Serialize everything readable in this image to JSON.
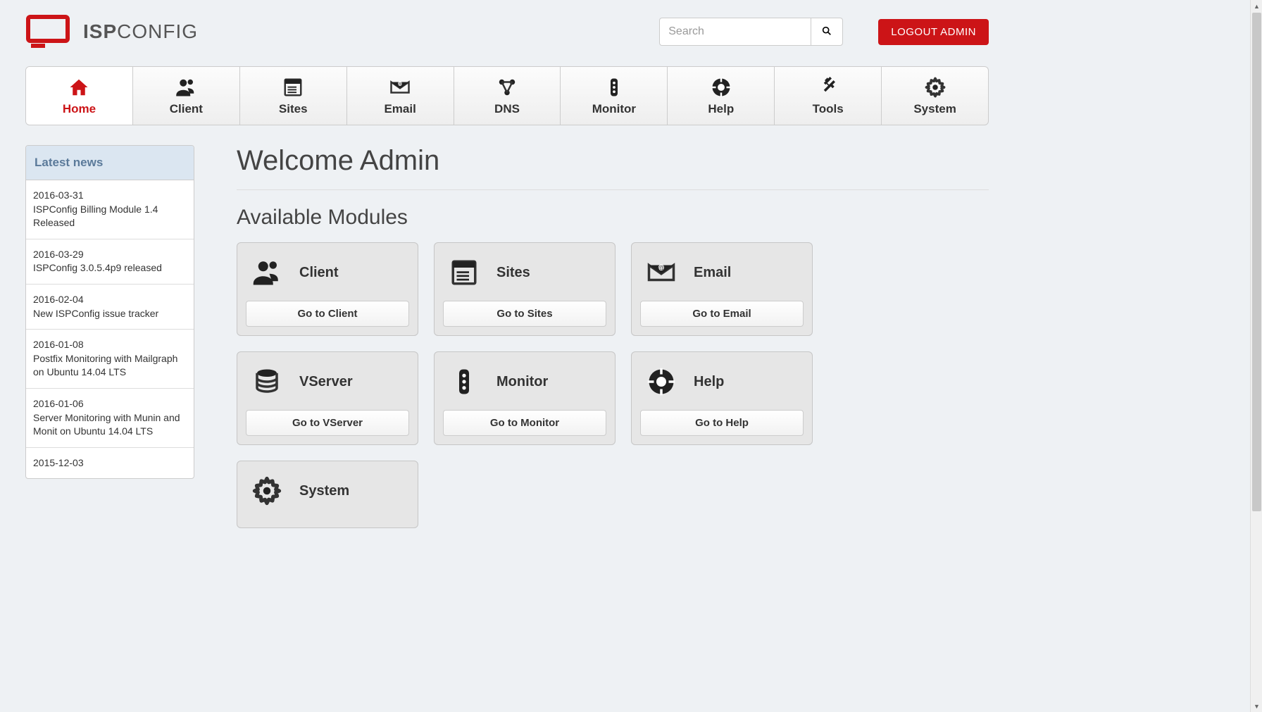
{
  "brand": {
    "bold": "ISP",
    "light": "CONFIG"
  },
  "search": {
    "placeholder": "Search"
  },
  "logout": {
    "label": "LOGOUT ADMIN"
  },
  "nav": {
    "items": [
      {
        "label": "Home",
        "icon": "home",
        "active": true
      },
      {
        "label": "Client",
        "icon": "client",
        "active": false
      },
      {
        "label": "Sites",
        "icon": "sites",
        "active": false
      },
      {
        "label": "Email",
        "icon": "email",
        "active": false
      },
      {
        "label": "DNS",
        "icon": "dns",
        "active": false
      },
      {
        "label": "Monitor",
        "icon": "monitor",
        "active": false
      },
      {
        "label": "Help",
        "icon": "help",
        "active": false
      },
      {
        "label": "Tools",
        "icon": "tools",
        "active": false
      },
      {
        "label": "System",
        "icon": "system",
        "active": false
      }
    ]
  },
  "sidebar": {
    "header": "Latest news",
    "news": [
      {
        "date": "2016-03-31",
        "title": "ISPConfig Billing Module 1.4 Released"
      },
      {
        "date": "2016-03-29",
        "title": "ISPConfig 3.0.5.4p9 released"
      },
      {
        "date": "2016-02-04",
        "title": "New ISPConfig issue tracker"
      },
      {
        "date": "2016-01-08",
        "title": "Postfix Monitoring with Mailgraph on Ubuntu 14.04 LTS"
      },
      {
        "date": "2016-01-06",
        "title": "Server Monitoring with Munin and Monit on Ubuntu 14.04 LTS"
      },
      {
        "date": "2015-12-03",
        "title": ""
      }
    ]
  },
  "main": {
    "welcome": "Welcome Admin",
    "section_title": "Available Modules",
    "modules": [
      {
        "title": "Client",
        "button": "Go to Client",
        "icon": "client"
      },
      {
        "title": "Sites",
        "button": "Go to Sites",
        "icon": "sites"
      },
      {
        "title": "Email",
        "button": "Go to Email",
        "icon": "email"
      },
      {
        "title": "VServer",
        "button": "Go to VServer",
        "icon": "vserver"
      },
      {
        "title": "Monitor",
        "button": "Go to Monitor",
        "icon": "monitor"
      },
      {
        "title": "Help",
        "button": "Go to Help",
        "icon": "help"
      },
      {
        "title": "System",
        "button": "",
        "icon": "system"
      }
    ]
  }
}
